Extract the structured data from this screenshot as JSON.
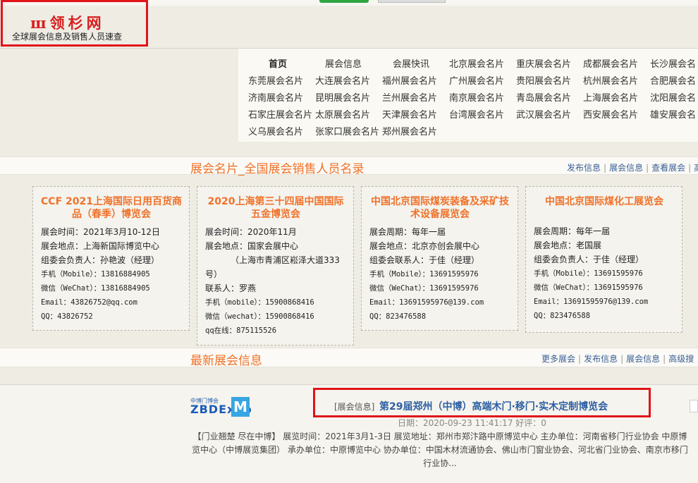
{
  "logo": {
    "mark": "ш领杉网",
    "subtitle": "全球展会信息及销售人员速查"
  },
  "nav": {
    "rows": [
      [
        "首页",
        "展会信息",
        "会展快讯",
        "北京展会名片",
        "重庆展会名片",
        "成都展会名片",
        "长沙展会名"
      ],
      [
        "东莞展会名片",
        "大连展会名片",
        "福州展会名片",
        "广州展会名片",
        "贵阳展会名片",
        "杭州展会名片",
        "合肥展会名"
      ],
      [
        "济南展会名片",
        "昆明展会名片",
        "兰州展会名片",
        "南京展会名片",
        "青岛展会名片",
        "上海展会名片",
        "沈阳展会名"
      ],
      [
        "石家庄展会名片",
        "太原展会名片",
        "天津展会名片",
        "台湾展会名片",
        "武汉展会名片",
        "西安展会名片",
        "雄安展会名"
      ],
      [
        "义乌展会名片",
        "张家口展会名片",
        "郑州展会名片"
      ]
    ]
  },
  "section1": {
    "title": "展会名片_全国展会销售人员名录",
    "links": [
      "发布信息",
      "展会信息",
      "查看展会",
      "高"
    ]
  },
  "cards": [
    {
      "title": "CCF 2021上海国际日用百货商品（春季）博览会",
      "lines": [
        "展会时间：2021年3月10-12日",
        "展会地点：上海新国际博览中心",
        "组委会负责人：孙艳波（经理）",
        "手机（Mobile）：13816884905",
        "微信（WeChat）：13816884905",
        "Email：43826752@qq.com",
        "QQ：43826752"
      ]
    },
    {
      "title": "2020上海第三十四届中国国际五金博览会",
      "lines": [
        "展会时间：2020年11月",
        "展会地点：国家会展中心",
        "（上海市青浦区崧泽大道333",
        "号）",
        "联系人：罗燕",
        "手机（mobile）：15900868416",
        "微信（wechat）：15900868416",
        "qq在线：875115526"
      ]
    },
    {
      "title": "中国北京国际煤炭装备及采矿技术设备展览会",
      "lines": [
        "展会周期：每年一届",
        "展会地点：北京亦创会展中心",
        "组委会联系人：于佳（经理）",
        "手机（Mobile）：13691595976",
        "微信（WeChat）：13691595976",
        "Email：13691595976@139.com",
        "QQ：823476588"
      ]
    },
    {
      "title": "中国北京国际煤化工展览会",
      "lines": [
        "展会周期：每年一届",
        "展会地点：老国展",
        "组委会负责人：于佳（经理）",
        "手机（Mobile）：13691595976",
        "微信（WeChat）：13691595976",
        "Email：13691595976@139.com",
        "QQ：823476588"
      ]
    }
  ],
  "section2": {
    "title": "最新展会信息",
    "links": [
      "更多展会",
      "发布信息",
      "展会信息",
      "高级搜"
    ]
  },
  "latest": {
    "logo_small": "中博门博会",
    "logo_big": "ZBDExpo",
    "logo_m": "M",
    "category": "[展会信息]",
    "title": "第29届郑州（中博）高端木门·移门·实木定制博览会",
    "date": "日期：2020-09-23 11:41:17 好评：0",
    "description": "【门业翘楚 尽在中博】 展览时间：2021年3月1-3日 展览地址：郑州市郑汴路中原博览中心 主办单位：河南省移门行业协会 中原博览中心（中博展览集团） 承办单位：中原博览中心 协办单位：中国木材流通协会、佛山市门窗业协会、河北省门业协会、南京市移门行业协..."
  }
}
